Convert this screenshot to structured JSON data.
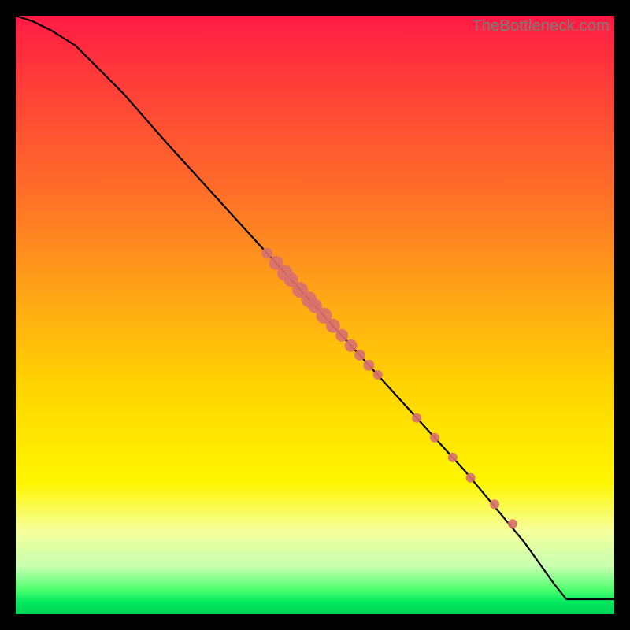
{
  "watermark": "TheBottleneck.com",
  "chart_data": {
    "type": "line",
    "title": "",
    "xlabel": "",
    "ylabel": "",
    "xlim": [
      0,
      100
    ],
    "ylim": [
      0,
      100
    ],
    "series": [
      {
        "name": "curve",
        "x": [
          0,
          3,
          6,
          10,
          14,
          18,
          25,
          35,
          45,
          55,
          65,
          75,
          85,
          90,
          92,
          100
        ],
        "y": [
          100,
          99,
          97.5,
          95,
          91,
          87,
          79,
          68,
          57,
          46,
          35,
          24,
          12,
          5,
          2.5,
          2.5
        ]
      }
    ],
    "markers": {
      "name": "highlighted-points",
      "x": [
        42,
        43.5,
        45,
        46,
        47.5,
        49,
        50,
        51.5,
        53,
        54.5,
        56,
        57.5,
        59,
        60.5,
        67,
        70,
        73,
        76,
        80,
        83
      ],
      "y": [
        60.3,
        58.7,
        57.0,
        55.9,
        54.2,
        52.6,
        51.5,
        49.9,
        48.2,
        46.6,
        44.9,
        43.3,
        41.6,
        40.0,
        32.8,
        29.5,
        26.2,
        22.8,
        18.4,
        15.1
      ],
      "r": [
        7,
        9,
        10,
        9,
        10,
        10,
        9,
        10,
        9,
        8,
        8,
        7,
        7,
        6,
        6,
        6,
        6,
        6,
        6,
        6
      ]
    }
  }
}
